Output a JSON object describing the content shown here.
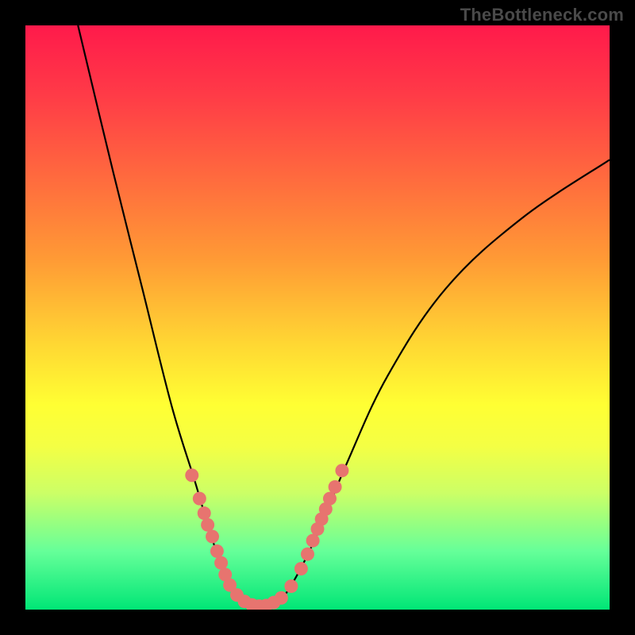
{
  "watermark": "TheBottleneck.com",
  "colors": {
    "frame": "#000000",
    "curve": "#000000",
    "marker": "#e7746f",
    "gradient_top": "#ff1a4b",
    "gradient_bottom": "#00e676"
  },
  "chart_data": {
    "type": "line",
    "title": "",
    "xlabel": "",
    "ylabel": "",
    "xlim": [
      0,
      100
    ],
    "ylim": [
      0,
      100
    ],
    "curve_points": [
      {
        "x": 9,
        "y": 100
      },
      {
        "x": 15,
        "y": 75
      },
      {
        "x": 20,
        "y": 55
      },
      {
        "x": 25,
        "y": 35
      },
      {
        "x": 29,
        "y": 22
      },
      {
        "x": 32,
        "y": 12
      },
      {
        "x": 35,
        "y": 4
      },
      {
        "x": 38,
        "y": 1
      },
      {
        "x": 40,
        "y": 0
      },
      {
        "x": 43,
        "y": 1
      },
      {
        "x": 46,
        "y": 5
      },
      {
        "x": 50,
        "y": 13
      },
      {
        "x": 55,
        "y": 25
      },
      {
        "x": 62,
        "y": 40
      },
      {
        "x": 72,
        "y": 55
      },
      {
        "x": 85,
        "y": 67
      },
      {
        "x": 100,
        "y": 77
      }
    ],
    "markers": [
      {
        "x": 28.5,
        "y": 23
      },
      {
        "x": 29.8,
        "y": 19
      },
      {
        "x": 30.6,
        "y": 16.5
      },
      {
        "x": 31.2,
        "y": 14.5
      },
      {
        "x": 32.0,
        "y": 12.5
      },
      {
        "x": 32.8,
        "y": 10.0
      },
      {
        "x": 33.5,
        "y": 8.0
      },
      {
        "x": 34.2,
        "y": 6.0
      },
      {
        "x": 35.0,
        "y": 4.2
      },
      {
        "x": 36.2,
        "y": 2.5
      },
      {
        "x": 37.5,
        "y": 1.4
      },
      {
        "x": 38.8,
        "y": 0.8
      },
      {
        "x": 40.0,
        "y": 0.6
      },
      {
        "x": 41.2,
        "y": 0.7
      },
      {
        "x": 42.5,
        "y": 1.2
      },
      {
        "x": 43.8,
        "y": 2.0
      },
      {
        "x": 45.5,
        "y": 4.0
      },
      {
        "x": 47.2,
        "y": 7.0
      },
      {
        "x": 48.3,
        "y": 9.5
      },
      {
        "x": 49.2,
        "y": 11.8
      },
      {
        "x": 50.0,
        "y": 13.8
      },
      {
        "x": 50.7,
        "y": 15.5
      },
      {
        "x": 51.4,
        "y": 17.2
      },
      {
        "x": 52.1,
        "y": 19.0
      },
      {
        "x": 53.0,
        "y": 21.0
      },
      {
        "x": 54.2,
        "y": 23.8
      }
    ]
  }
}
